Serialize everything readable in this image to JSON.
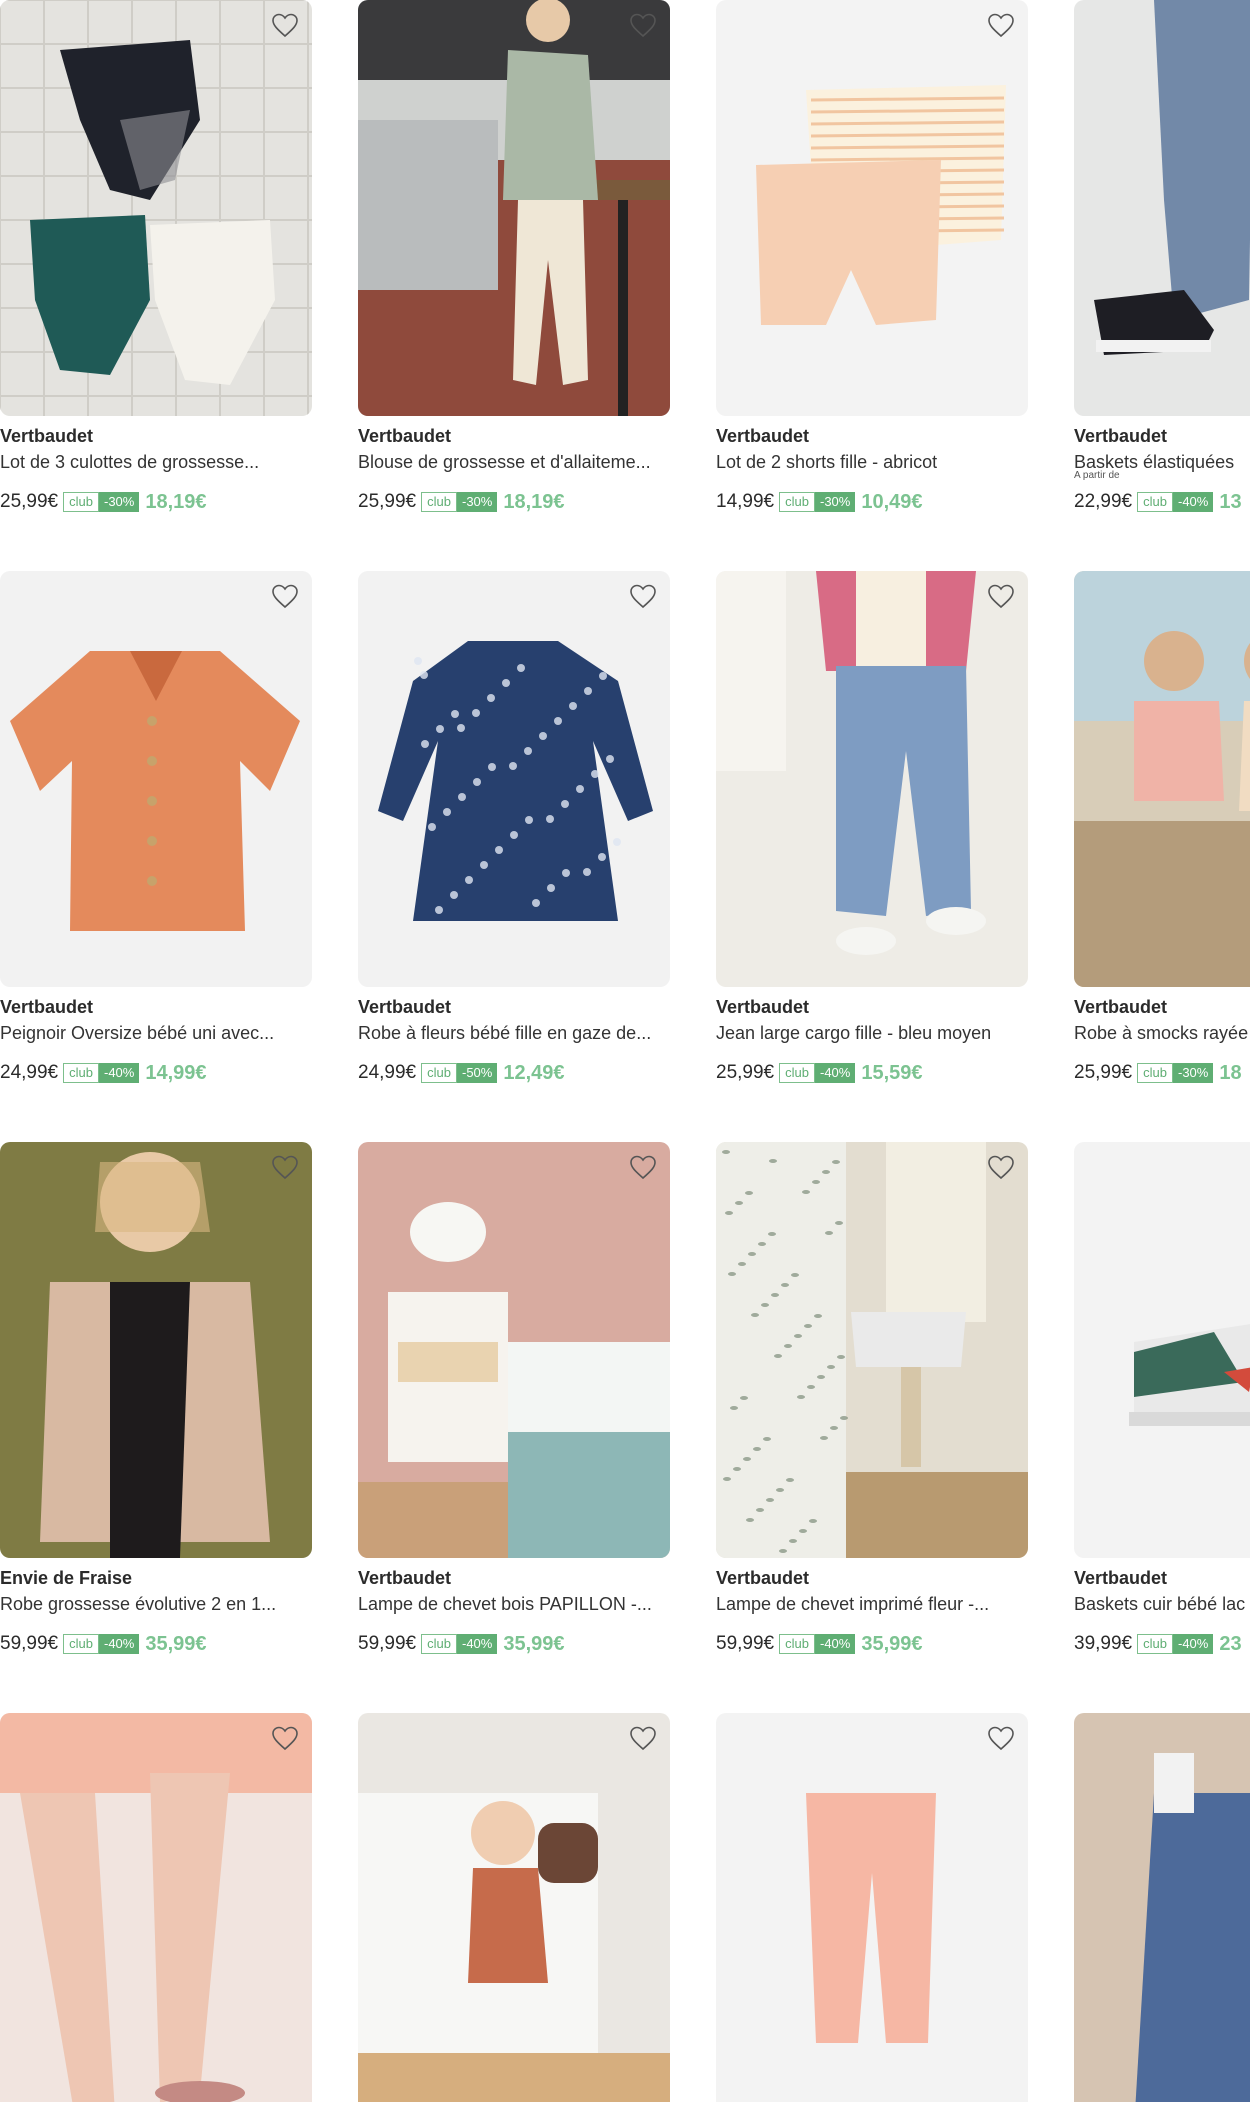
{
  "colors": {
    "accent_green": "#5fae73",
    "new_price_green": "#7cc391",
    "text": "#2b2b2b"
  },
  "favorite_icon": "heart-outline-icon",
  "products": [
    {
      "brand": "Vertbaudet",
      "title": "Lot de 3 culottes de grossesse...",
      "from_label": "",
      "old_price": "25,99€",
      "club_label": "club",
      "discount": "-30%",
      "new_price": "18,19€"
    },
    {
      "brand": "Vertbaudet",
      "title": "Blouse de grossesse et d'allaiteme...",
      "from_label": "",
      "old_price": "25,99€",
      "club_label": "club",
      "discount": "-30%",
      "new_price": "18,19€"
    },
    {
      "brand": "Vertbaudet",
      "title": "Lot de 2 shorts fille - abricot",
      "from_label": "",
      "old_price": "14,99€",
      "club_label": "club",
      "discount": "-30%",
      "new_price": "10,49€"
    },
    {
      "brand": "Vertbaudet",
      "title": "Baskets élastiquées",
      "from_label": "A partir de",
      "old_price": "22,99€",
      "club_label": "club",
      "discount": "-40%",
      "new_price": "13"
    },
    {
      "brand": "Vertbaudet",
      "title": "Peignoir Oversize bébé uni avec...",
      "from_label": "",
      "old_price": "24,99€",
      "club_label": "club",
      "discount": "-40%",
      "new_price": "14,99€"
    },
    {
      "brand": "Vertbaudet",
      "title": "Robe à fleurs bébé fille en gaze de...",
      "from_label": "",
      "old_price": "24,99€",
      "club_label": "club",
      "discount": "-50%",
      "new_price": "12,49€"
    },
    {
      "brand": "Vertbaudet",
      "title": "Jean large cargo fille - bleu moyen",
      "from_label": "",
      "old_price": "25,99€",
      "club_label": "club",
      "discount": "-40%",
      "new_price": "15,59€"
    },
    {
      "brand": "Vertbaudet",
      "title": "Robe à smocks rayée",
      "from_label": "",
      "old_price": "25,99€",
      "club_label": "club",
      "discount": "-30%",
      "new_price": "18"
    },
    {
      "brand": "Envie de Fraise",
      "title": "Robe grossesse évolutive 2 en 1...",
      "from_label": "",
      "old_price": "59,99€",
      "club_label": "club",
      "discount": "-40%",
      "new_price": "35,99€"
    },
    {
      "brand": "Vertbaudet",
      "title": "Lampe de chevet bois PAPILLON -...",
      "from_label": "",
      "old_price": "59,99€",
      "club_label": "club",
      "discount": "-40%",
      "new_price": "35,99€"
    },
    {
      "brand": "Vertbaudet",
      "title": "Lampe de chevet imprimé fleur -...",
      "from_label": "",
      "old_price": "59,99€",
      "club_label": "club",
      "discount": "-40%",
      "new_price": "35,99€"
    },
    {
      "brand": "Vertbaudet",
      "title": "Baskets cuir bébé lac",
      "from_label": "",
      "old_price": "39,99€",
      "club_label": "club",
      "discount": "-40%",
      "new_price": "23"
    },
    {
      "brand": "",
      "title": "",
      "from_label": "",
      "old_price": "",
      "club_label": "",
      "discount": "",
      "new_price": ""
    },
    {
      "brand": "",
      "title": "",
      "from_label": "",
      "old_price": "",
      "club_label": "",
      "discount": "",
      "new_price": ""
    },
    {
      "brand": "",
      "title": "",
      "from_label": "",
      "old_price": "",
      "club_label": "",
      "discount": "",
      "new_price": ""
    },
    {
      "brand": "",
      "title": "",
      "from_label": "",
      "old_price": "",
      "club_label": "",
      "discount": "",
      "new_price": ""
    }
  ]
}
